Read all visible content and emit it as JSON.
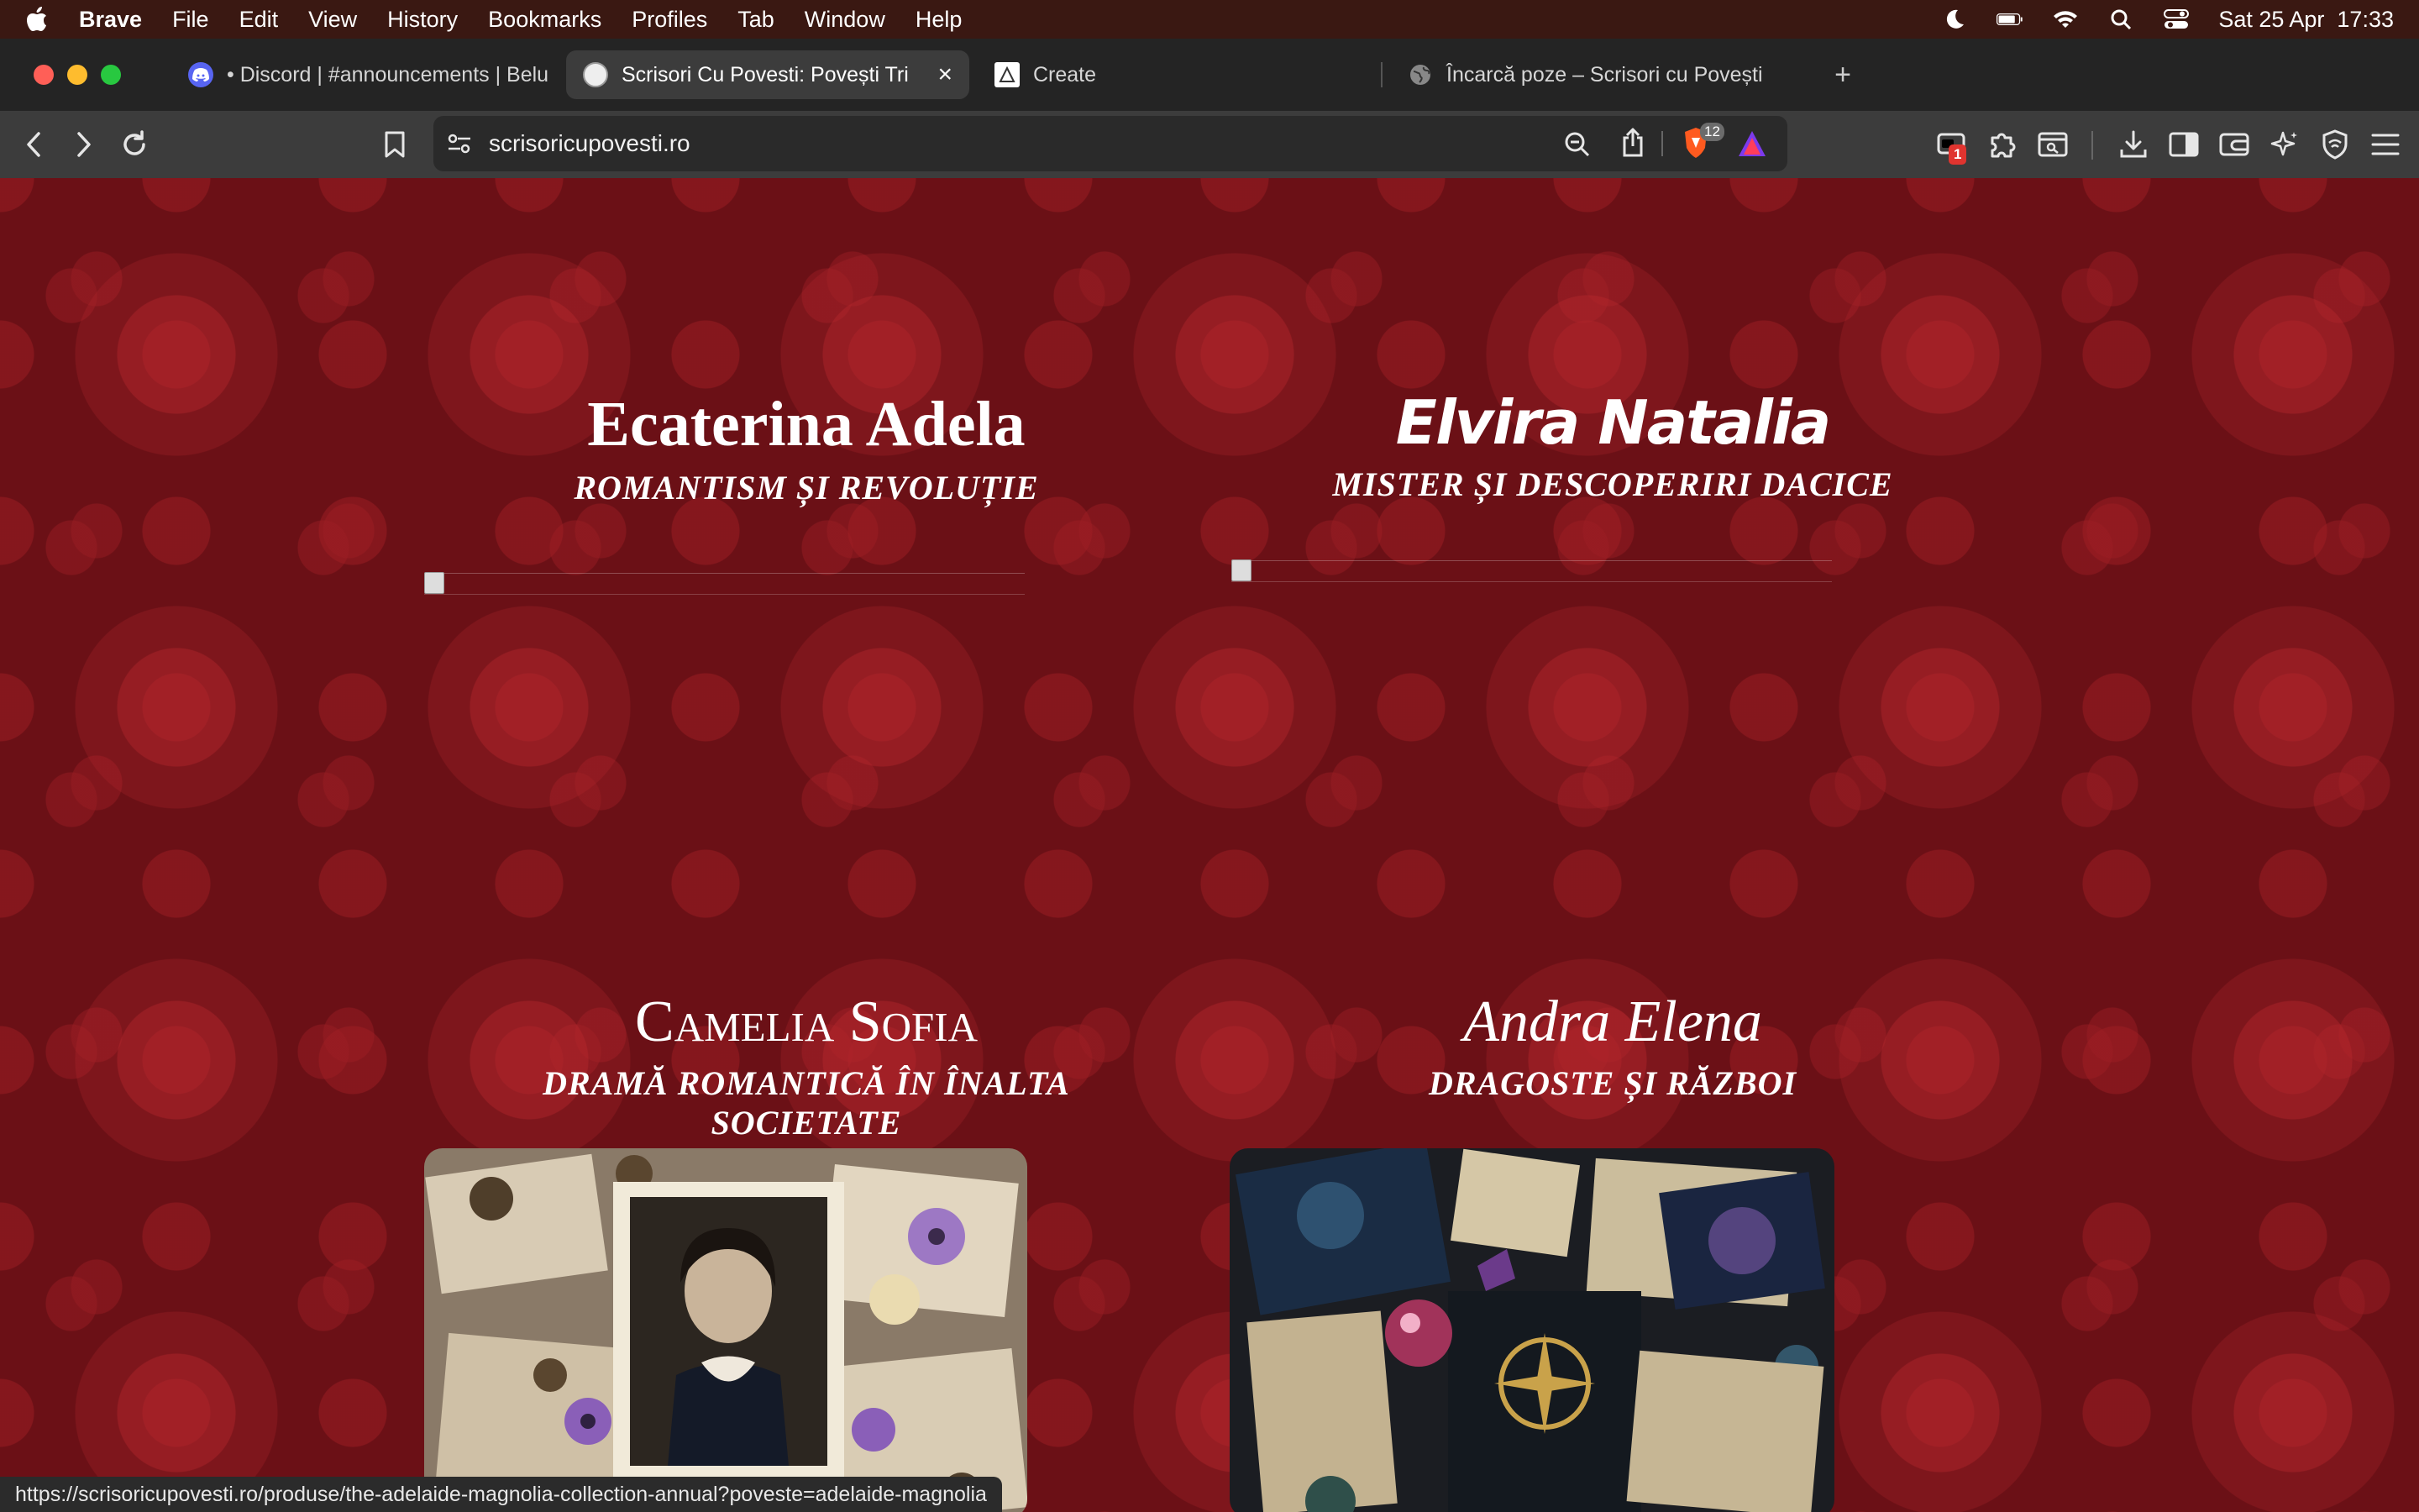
{
  "menubar": {
    "app_name": "Brave",
    "items": [
      "File",
      "Edit",
      "View",
      "History",
      "Bookmarks",
      "Profiles",
      "Tab",
      "Window",
      "Help"
    ],
    "datetime": "Sat 25 Apr  17:33"
  },
  "tabs": [
    {
      "title": "• Discord | #announcements | Belu",
      "icon": "discord-icon",
      "active": false
    },
    {
      "title": "Scrisori Cu Povesti: Povești Tri",
      "icon": "site-favicon",
      "active": true
    },
    {
      "title": "Create",
      "icon": "create-icon",
      "active": false
    },
    {
      "title": "Încarcă poze – Scrisori cu Povești",
      "icon": "globe-icon",
      "active": false
    }
  ],
  "toolbar": {
    "url": "scrisoricupovesti.ro",
    "shields_count": "12",
    "extension_badge": "1"
  },
  "cards": [
    {
      "name": "Ecaterina Adela",
      "subtitle": "ROMANTISM ȘI REVOLUȚIE"
    },
    {
      "name": "Elvira Natalia",
      "subtitle": "MISTER ȘI DESCOPERIRI DACICE"
    },
    {
      "name": "Camelia Sofia",
      "subtitle": "DRAMĂ ROMANTICĂ ÎN ÎNALTA SOCIETATE"
    },
    {
      "name": "Andra Elena",
      "subtitle": "DRAGOSTE ȘI RĂZBOI"
    }
  ],
  "status_url": "https://scrisoricupovesti.ro/produse/the-adelaide-magnolia-collection-annual?poveste=adelaide-magnolia",
  "colors": {
    "background": "#6b1016",
    "damask": "#b9282e",
    "text": "#ffffff"
  }
}
